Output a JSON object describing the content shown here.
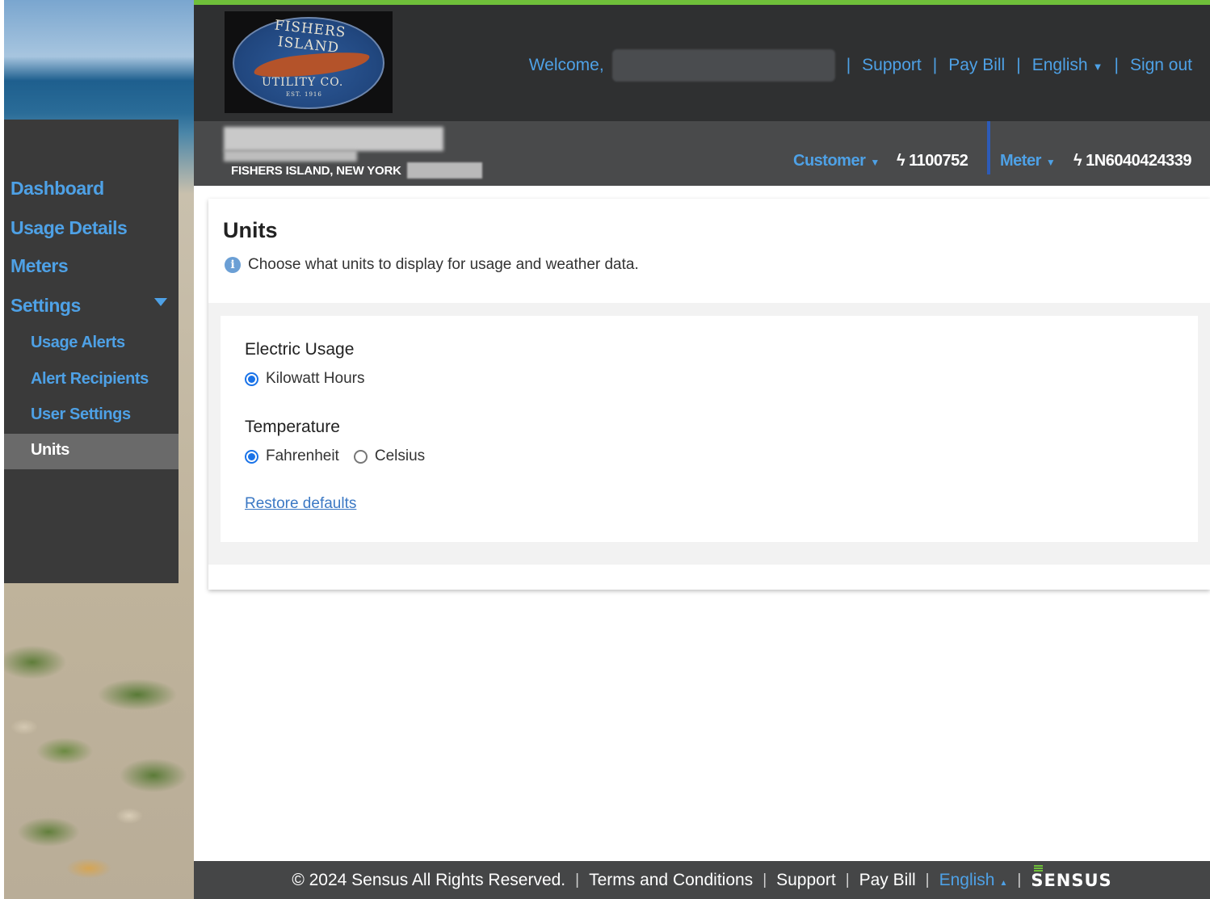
{
  "brand": {
    "logo_top": "FISHERS ISLAND",
    "logo_bottom": "UTILITY CO.",
    "logo_est": "EST. 1916"
  },
  "header": {
    "welcome": "Welcome,",
    "links": [
      "Support",
      "Pay Bill",
      "English",
      "Sign out"
    ]
  },
  "account": {
    "city": "FISHERS ISLAND, NEW YORK",
    "customer_label": "Customer",
    "customer_value": "1100752",
    "meter_label": "Meter",
    "meter_value": "1N6040424339"
  },
  "sidebar": {
    "items": [
      "Dashboard",
      "Usage Details",
      "Meters",
      "Settings"
    ],
    "sub_items": [
      "Usage Alerts",
      "Alert Recipients",
      "User Settings",
      "Units"
    ],
    "active": "Units"
  },
  "main": {
    "title": "Units",
    "info": "Choose what units to display for usage and weather data.",
    "electric": {
      "heading": "Electric Usage",
      "options": [
        "Kilowatt Hours"
      ],
      "selected": "Kilowatt Hours"
    },
    "temperature": {
      "heading": "Temperature",
      "options": [
        "Fahrenheit",
        "Celsius"
      ],
      "selected": "Fahrenheit"
    },
    "restore": "Restore defaults"
  },
  "footer": {
    "copyright": "© 2024 Sensus All Rights Reserved.",
    "terms": "Terms and Conditions",
    "support": "Support",
    "pay_bill": "Pay Bill",
    "language": "English",
    "brand": "SENSUS"
  },
  "colors": {
    "accent": "#4ea1e6",
    "header_bg": "#2f3031",
    "header_border": "#6fbf3a",
    "account_bg": "#494a4b",
    "radio": "#1a73e8"
  }
}
